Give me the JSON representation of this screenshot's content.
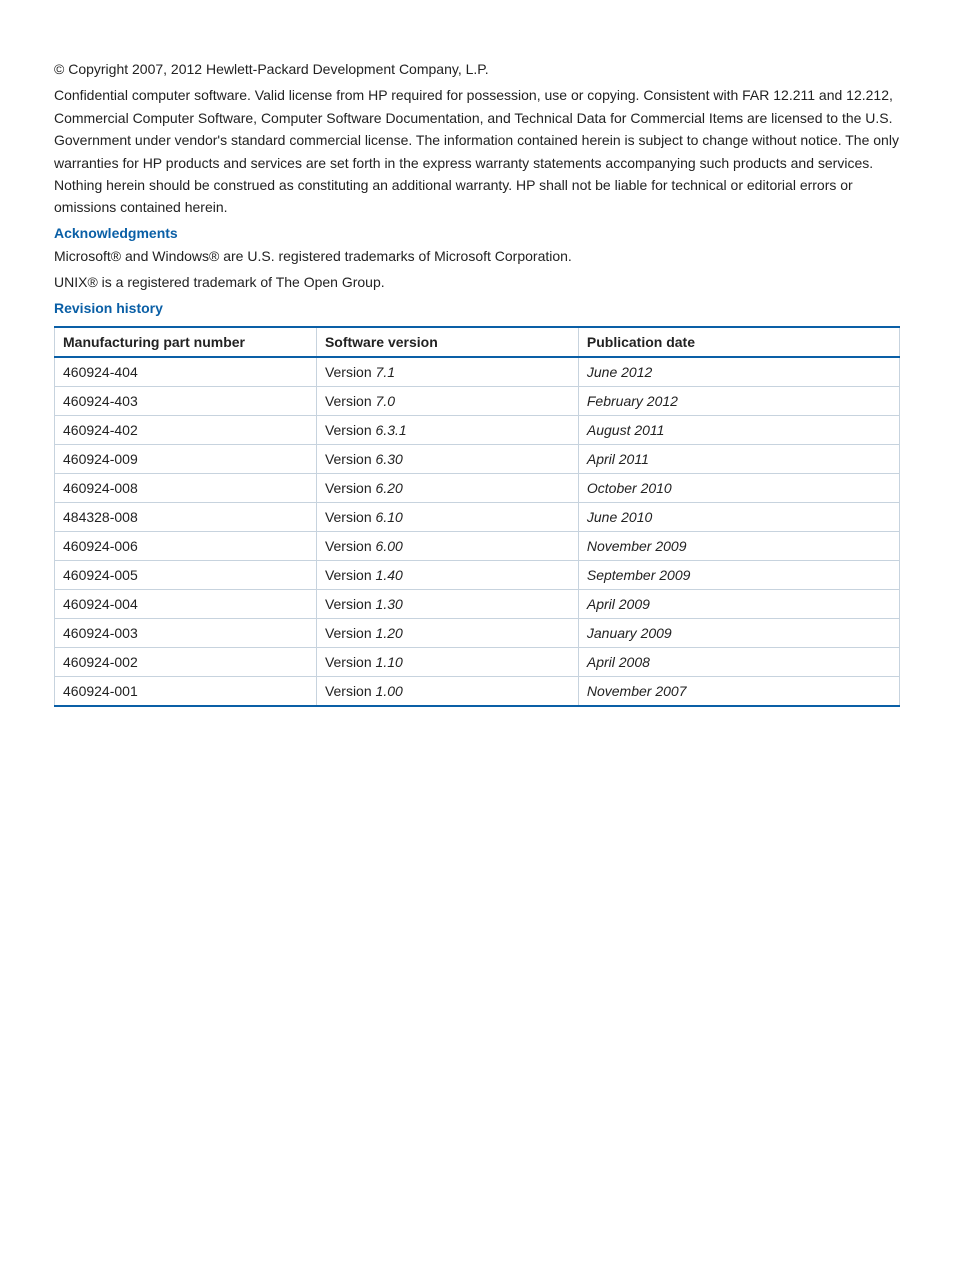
{
  "copyright": "© Copyright 2007, 2012 Hewlett-Packard Development Company, L.P.",
  "legal": "Confidential computer software. Valid license from HP required for possession, use or copying. Consistent with FAR 12.211 and 12.212, Commercial Computer Software, Computer Software Documentation, and Technical Data for Commercial Items are licensed to the U.S. Government under vendor's standard commercial license. The information contained herein is subject to change without notice. The only warranties for HP products and services are set forth in the express warranty statements accompanying such products and services. Nothing herein should be construed as constituting an additional warranty. HP shall not be liable for technical or editorial errors or omissions contained herein.",
  "ack_heading": "Acknowledgments",
  "ack_line1": "Microsoft® and Windows® are U.S. registered trademarks of Microsoft Corporation.",
  "ack_line2": "UNIX® is a registered trademark of The Open Group.",
  "rev_heading": "Revision history",
  "table": {
    "headers": {
      "part": "Manufacturing part number",
      "version": "Software version",
      "date": "Publication date"
    },
    "rows": [
      {
        "part": "460924-404",
        "vprefix": "Version ",
        "vnum": "7.1",
        "date": "June 2012"
      },
      {
        "part": "460924-403",
        "vprefix": "Version ",
        "vnum": "7.0",
        "date": "February 2012"
      },
      {
        "part": "460924-402",
        "vprefix": "Version ",
        "vnum": "6.3.1",
        "date": "August 2011"
      },
      {
        "part": "460924-009",
        "vprefix": "Version ",
        "vnum": "6.30",
        "date": "April 2011"
      },
      {
        "part": "460924-008",
        "vprefix": "Version ",
        "vnum": "6.20",
        "date": "October 2010"
      },
      {
        "part": "484328-008",
        "vprefix": "Version ",
        "vnum": "6.10",
        "date": "June 2010"
      },
      {
        "part": "460924-006",
        "vprefix": "Version ",
        "vnum": "6.00",
        "date": "November 2009"
      },
      {
        "part": "460924-005",
        "vprefix": "Version ",
        "vnum": "1.40",
        "date": "September 2009"
      },
      {
        "part": "460924-004",
        "vprefix": "Version ",
        "vnum": "1.30",
        "date": "April 2009"
      },
      {
        "part": "460924-003",
        "vprefix": "Version ",
        "vnum": "1.20",
        "date": "January 2009"
      },
      {
        "part": "460924-002",
        "vprefix": "Version ",
        "vnum": "1.10",
        "date": "April 2008"
      },
      {
        "part": "460924-001",
        "vprefix": "Version ",
        "vnum": "1.00",
        "date": "November 2007"
      }
    ]
  }
}
